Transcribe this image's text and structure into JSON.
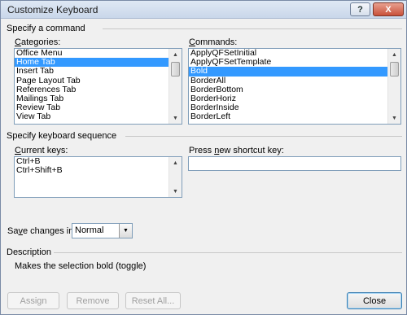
{
  "window": {
    "title": "Customize Keyboard",
    "help_icon": "?",
    "close_icon": "X"
  },
  "command_section": {
    "title": "Specify a command"
  },
  "categories": {
    "label": "Categories:",
    "items": [
      "Office Menu",
      "Home Tab",
      "Insert Tab",
      "Page Layout Tab",
      "References Tab",
      "Mailings Tab",
      "Review Tab",
      "View Tab"
    ],
    "selected_index": 1
  },
  "commands": {
    "label": "Commands:",
    "items": [
      "ApplyQFSetInitial",
      "ApplyQFSetTemplate",
      "Bold",
      "BorderAll",
      "BorderBottom",
      "BorderHoriz",
      "BorderInside",
      "BorderLeft"
    ],
    "selected_index": 2
  },
  "sequence_section": {
    "title": "Specify keyboard sequence"
  },
  "current_keys": {
    "label": "Current keys:",
    "items": [
      "Ctrl+B",
      "Ctrl+Shift+B"
    ]
  },
  "new_shortcut": {
    "label": "Press new shortcut key:",
    "value": ""
  },
  "save_changes": {
    "label": "Save changes in:",
    "value": "Normal"
  },
  "description": {
    "title": "Description",
    "text": "Makes the selection bold (toggle)"
  },
  "buttons": {
    "assign": "Assign",
    "remove": "Remove",
    "reset_all": "Reset All...",
    "close": "Close"
  },
  "glyphs": {
    "up": "▲",
    "down": "▼"
  }
}
